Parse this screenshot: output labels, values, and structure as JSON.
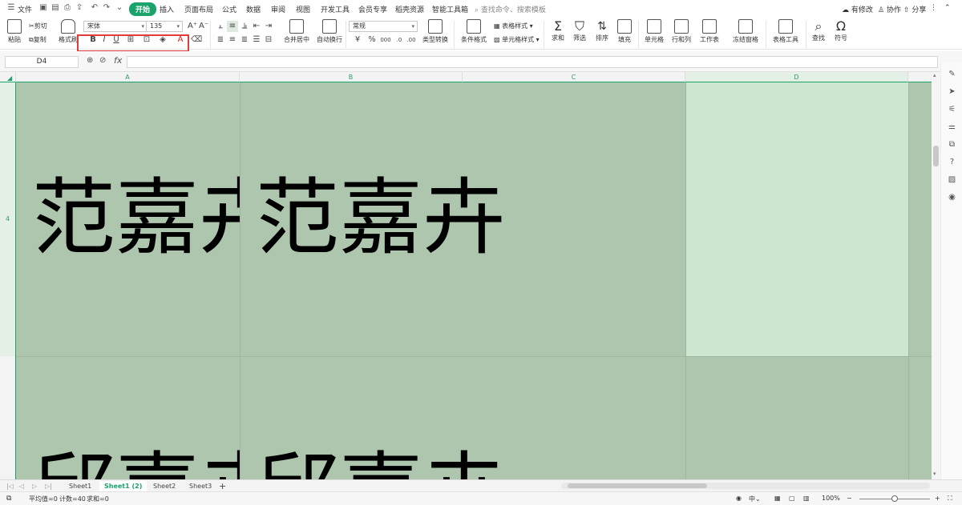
{
  "menubar": {
    "file_label": "文件",
    "tabs": [
      "开始",
      "插入",
      "页面布局",
      "公式",
      "数据",
      "审阅",
      "视图",
      "开发工具",
      "会员专享",
      "稻壳资源",
      "智能工具箱"
    ],
    "active_tab": "开始",
    "search_placeholder": "查找命令、搜索模板",
    "right_items": [
      "有修改",
      "协作",
      "分享"
    ]
  },
  "ribbon": {
    "paste": "粘贴",
    "cut": "剪切",
    "copy": "复制",
    "format_painter": "格式刷",
    "font_name": "宋体",
    "font_size": "135",
    "bold": "B",
    "italic": "I",
    "underline": "U",
    "merge_center": "合并居中",
    "wrap_text": "自动换行",
    "number_format": "常规",
    "type_convert": "类型转换",
    "conditional_format": "条件格式",
    "table_style": "表格样式",
    "cell_style": "单元格样式",
    "sum": "求和",
    "filter": "筛选",
    "sort": "排序",
    "fill": "填充",
    "cell": "单元格",
    "row_col": "行和列",
    "worksheet": "工作表",
    "freeze_panes": "冻结窗格",
    "table_tools": "表格工具",
    "find": "查找",
    "symbol": "符号"
  },
  "formulabar": {
    "cell_ref": "D4",
    "fx": "fx",
    "content": ""
  },
  "grid": {
    "columns": [
      "A",
      "B",
      "C",
      "D"
    ],
    "rows": [
      "4"
    ],
    "cells": {
      "A4": "范嘉卉",
      "B4": "范嘉卉",
      "A5": "邱嘉卉",
      "B5": "邱嘉卉"
    }
  },
  "sheets": {
    "tabs": [
      "Sheet1",
      "Sheet1 (2)",
      "Sheet2",
      "Sheet3"
    ],
    "active": "Sheet1 (2)",
    "add_label": "+"
  },
  "statusbar": {
    "average": "平均值=0",
    "count": "计数=40",
    "sum": "求和=0",
    "zoom": "100%"
  },
  "colors": {
    "accent": "#1aa36b",
    "cell_bg": "#aec5ae",
    "selected_cell_bg": "#cce6cf",
    "highlight_rect": "#e23b3b"
  }
}
